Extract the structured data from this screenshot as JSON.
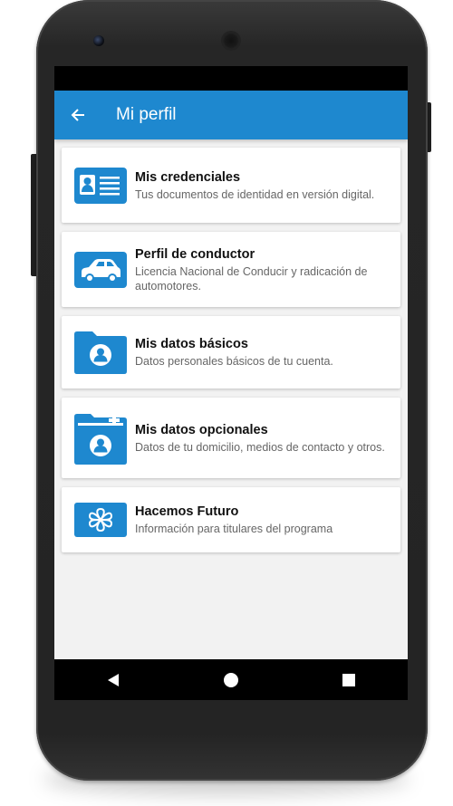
{
  "appbar": {
    "title": "Mi perfil",
    "back_icon": "arrow-back-icon"
  },
  "colors": {
    "primary": "#1e88cf",
    "card_bg": "#ffffff",
    "screen_bg": "#f2f2f2"
  },
  "items": [
    {
      "icon": "id-card-icon",
      "title": "Mis credenciales",
      "desc": "Tus documentos de identidad en versión digital."
    },
    {
      "icon": "car-icon",
      "title": "Perfil de conductor",
      "desc": "Licencia Nacional de Conducir y radicación de automotores."
    },
    {
      "icon": "folder-user-icon",
      "title": "Mis datos básicos",
      "desc": "Datos personales básicos de tu cuenta."
    },
    {
      "icon": "folder-user-add-icon",
      "title": "Mis datos opcionales",
      "desc": "Datos de tu domicilio, medios de contacto y otros."
    },
    {
      "icon": "hacemos-futuro-icon",
      "title": "Hacemos Futuro",
      "desc": "Información para titulares del programa"
    }
  ],
  "navbar": {
    "back": "triangle-back-icon",
    "home": "circle-home-icon",
    "recents": "square-recents-icon"
  }
}
